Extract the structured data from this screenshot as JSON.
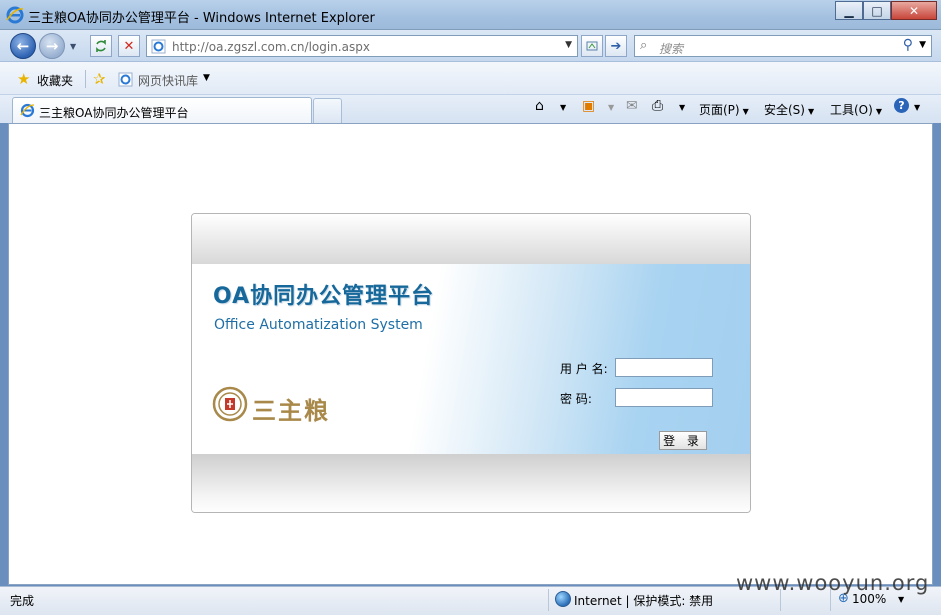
{
  "window": {
    "title": "三主粮OA协同办公管理平台 - Windows Internet Explorer",
    "minimize": "▁",
    "maximize": "□",
    "close": "✕"
  },
  "nav": {
    "back": "←",
    "forward": "→",
    "url": "http://oa.zgszl.com.cn/login.aspx",
    "search_placeholder": "搜索"
  },
  "favorites": {
    "favorites_label": "收藏夹",
    "quick_label": "网页快讯库"
  },
  "tabs": [
    {
      "label": "三主粮OA协同办公管理平台"
    }
  ],
  "commands": {
    "page": "页面(P)",
    "safety": "安全(S)",
    "tools": "工具(O)"
  },
  "login": {
    "system_title": "OA协同办公管理平台",
    "system_subtitle": "Office Automatization System",
    "logo_text": "三主粮",
    "username_label": "用 户 名:",
    "password_label": "密    码:",
    "username_value": "",
    "password_value": "",
    "submit_label": "登 录"
  },
  "status": {
    "text": "完成",
    "zone": "Internet | 保护模式: 禁用",
    "zoom": "100%"
  },
  "watermark": "www.wooyun.org"
}
